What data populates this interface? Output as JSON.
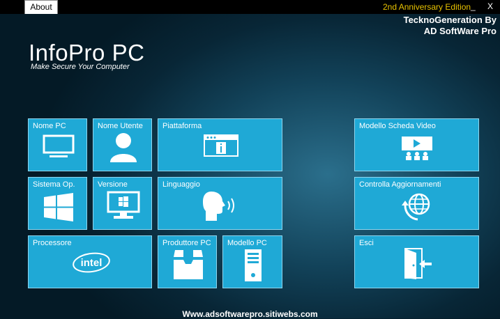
{
  "topbar": {
    "about_tab": "About",
    "edition": "2nd Anniversary Edition",
    "minimize": "_",
    "close": "X"
  },
  "brand": {
    "line1": "TecknoGeneration By",
    "line2": "AD SoftWare Pro"
  },
  "app": {
    "title": "InfoPro PC",
    "subtitle": "Make Secure Your Computer"
  },
  "tiles": {
    "nome_pc": "Nome PC",
    "nome_utente": "Nome Utente",
    "piattaforma": "Piattaforma",
    "sistema_op": "Sistema Op.",
    "versione": "Versione",
    "linguaggio": "Linguaggio",
    "processore": "Processore",
    "produttore_pc": "Produttore PC",
    "modello_pc": "Modello PC",
    "modello_scheda_video": "Modello Scheda Video",
    "controlla_aggiornamenti": "Controlla Aggiornamenti",
    "esci": "Esci",
    "intel_logo_text": "intel"
  },
  "footer": {
    "url": "Www.adsoftwarepro.sitiwebs.com"
  },
  "colors": {
    "tile": "#1fa9d6",
    "edition": "#e8c200"
  },
  "icons": [
    "monitor-icon",
    "user-icon",
    "window-info-icon",
    "windows-logo-icon",
    "pc-windows-icon",
    "speaking-head-icon",
    "intel-logo-icon",
    "box-icon",
    "tower-pc-icon",
    "presentation-icon",
    "globe-refresh-icon",
    "exit-door-icon"
  ]
}
